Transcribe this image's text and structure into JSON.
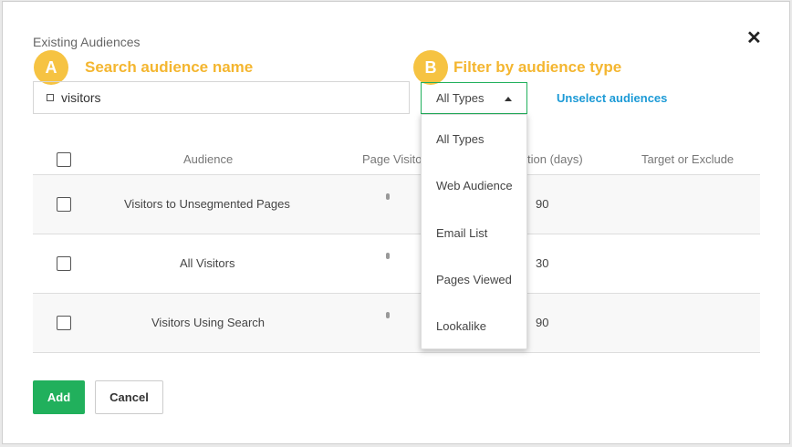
{
  "modal": {
    "title": "Existing Audiences",
    "close_glyph": "✕"
  },
  "callouts": {
    "a_badge": "A",
    "a_text": "Search audience name",
    "b_badge": "B",
    "b_text": "Filter by audience type"
  },
  "search": {
    "value": "visitors",
    "icon": "square-icon"
  },
  "type_filter": {
    "selected": "All Types",
    "options": [
      "All Types",
      "Web Audience",
      "Email List",
      "Pages Viewed",
      "Lookalike"
    ]
  },
  "unselect_label": "Unselect audiences",
  "table": {
    "headers": {
      "audience": "Audience",
      "page_visitors": "Page Visito",
      "duration": "tion (days)",
      "target": "Target or Exclude"
    },
    "rows": [
      {
        "audience": "Visitors to Unsegmented Pages",
        "duration": "90"
      },
      {
        "audience": "All Visitors",
        "duration": "30"
      },
      {
        "audience": "Visitors Using Search",
        "duration": "90"
      }
    ]
  },
  "buttons": {
    "add": "Add",
    "cancel": "Cancel"
  },
  "colors": {
    "accent_green": "#21b05c",
    "link_blue": "#1c9ad6",
    "callout_yellow": "#f4b630"
  }
}
